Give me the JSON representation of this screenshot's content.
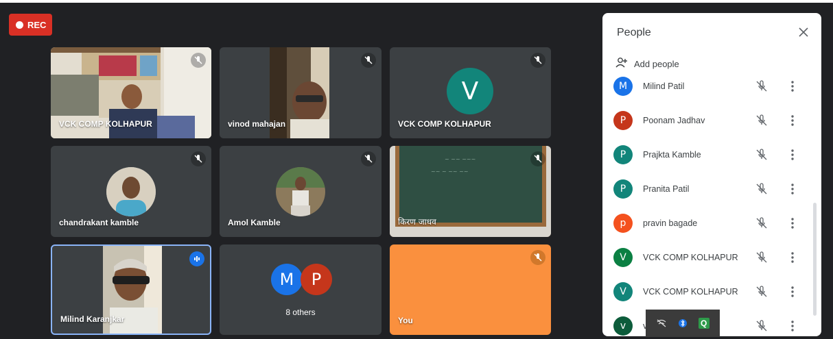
{
  "recording": {
    "label": "REC"
  },
  "tiles": [
    {
      "name": "VCK COMP KOLHAPUR"
    },
    {
      "name": "vinod mahajan"
    },
    {
      "name": "VCK COMP KOLHAPUR",
      "initial": "V"
    },
    {
      "name": "chandrakant kamble"
    },
    {
      "name": "Amol Kamble"
    },
    {
      "name": "किरण जाधव"
    },
    {
      "name": "Milind Karanjkar"
    },
    {
      "name": "8 others",
      "initials": [
        "M",
        "P"
      ]
    },
    {
      "name": "You"
    }
  ],
  "people_panel": {
    "title": "People",
    "add_people": "Add people",
    "participants": [
      {
        "initial": "M",
        "name": "Milind Patil",
        "color": "#1a73e8"
      },
      {
        "initial": "P",
        "name": "Poonam Jadhav",
        "color": "#c5361b"
      },
      {
        "initial": "P",
        "name": "Prajkta Kamble",
        "color": "#12857a"
      },
      {
        "initial": "P",
        "name": "Pranita Patil",
        "color": "#12857a"
      },
      {
        "initial": "p",
        "name": "pravin bagade",
        "color": "#f4511e"
      },
      {
        "initial": "V",
        "name": "VCK COMP KOLHAPUR",
        "color": "#0b8043"
      },
      {
        "initial": "V",
        "name": "VCK COMP KOLHAPUR",
        "color": "#12857a"
      },
      {
        "initial": "v",
        "name": "v",
        "color": "#0d5c3b"
      }
    ]
  },
  "colors": {
    "background": "#202124",
    "tile": "#3c4043",
    "rec": "#d93025",
    "you_tile": "#fa903e",
    "active_border": "#8ab4f8"
  },
  "taskbar": {
    "icons": [
      "wifi-off-icon",
      "bluetooth-icon",
      "q-app-icon"
    ],
    "q_label": "Q"
  }
}
